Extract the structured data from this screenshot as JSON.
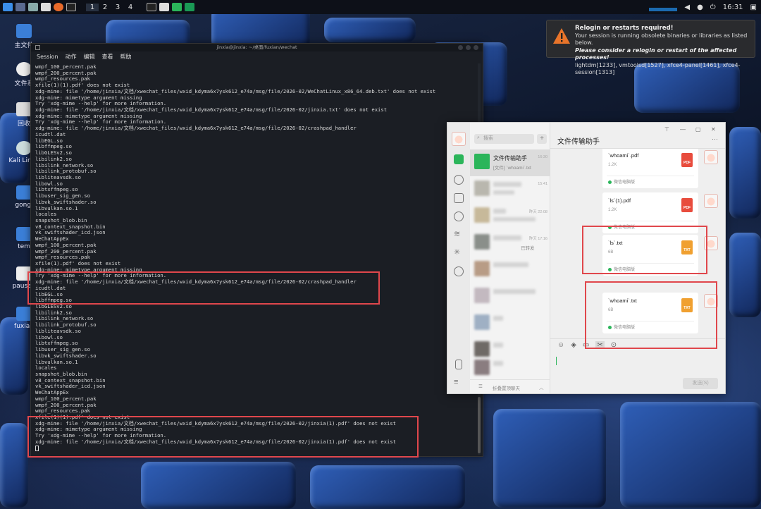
{
  "panel": {
    "workspaces": [
      "1",
      "2",
      "3",
      "4"
    ],
    "clock": "16:31"
  },
  "desktop_icons": [
    {
      "label": "主文件"
    },
    {
      "label": "文件系"
    },
    {
      "label": "回收"
    },
    {
      "label": "Kali Linux"
    },
    {
      "label": "gongj"
    },
    {
      "label": "tem"
    },
    {
      "label": ""
    },
    {
      "label": "paused"
    },
    {
      "label": "fuxian"
    }
  ],
  "notification": {
    "title": "Relogin or restarts required!",
    "line1": "Your session is running obsolete binaries or libraries as listed below.",
    "line2": "Please consider a relogin or restart of the affected processes!",
    "line3": "lightdm[1233], vmtoolsd[1527], xfce4-panel[1461], xfce4-session[1313]"
  },
  "terminal": {
    "title": "jinxia@jinxia: ~/桌面/fuxian/wechat",
    "menu": [
      "Session",
      "动作",
      "编辑",
      "查看",
      "帮助"
    ],
    "lines": [
      "wmpf_100_percent.pak",
      "wmpf_200_percent.pak",
      "wmpf_resources.pak",
      "xfile(1)(1).pdf' does not exist",
      "xdg-mime: file '/home/jinxia/文档/xwechat_files/wxid_kdyma6x7ysk612_e74a/msg/file/2026-02/WeChatLinux_x86_64.deb.txt' does not exist",
      "xdg-mime: mimetype argument missing",
      "Try 'xdg-mime --help' for more information.",
      "xdg-mime: file '/home/jinxia/文档/xwechat_files/wxid_kdyma6x7ysk612_e74a/msg/file/2026-02/jinxia.txt' does not exist",
      "xdg-mime: mimetype argument missing",
      "Try 'xdg-mime --help' for more information.",
      "xdg-mime: file '/home/jinxia/文档/xwechat_files/wxid_kdyma6x7ysk612_e74a/msg/file/2026-02/crashpad_handler",
      "icudtl.dat",
      "libEGL.so",
      "libffmpeg.so",
      "libGLESv2.so",
      "libilink2.so",
      "libilink_network.so",
      "libilink_protobuf.so",
      "libliteavsdk.so",
      "libowl.so",
      "libtxffmpeg.so",
      "libuser_sig_gen.so",
      "libvk_swiftshader.so",
      "libvulkan.so.1",
      "locales",
      "snapshot_blob.bin",
      "v8_context_snapshot.bin",
      "vk_swiftshader_icd.json",
      "WeChatAppEx",
      "wmpf_100_percent.pak",
      "wmpf_200_percent.pak",
      "wmpf_resources.pak",
      "xfile(1).pdf' does not exist",
      "xdg-mime: mimetype argument missing",
      "Try 'xdg-mime --help' for more information.",
      "xdg-mime: file '/home/jinxia/文档/xwechat_files/wxid_kdyma6x7ysk612_e74a/msg/file/2026-02/crashpad_handler",
      "icudtl.dat",
      "libEGL.so",
      "libffmpeg.so",
      "libGLESv2.so",
      "libilink2.so",
      "libilink_network.so",
      "libilink_protobuf.so",
      "libliteavsdk.so",
      "libowl.so",
      "libtxffmpeg.so",
      "libuser_sig_gen.so",
      "libvk_swiftshader.so",
      "libvulkan.so.1",
      "locales",
      "snapshot_blob.bin",
      "v8_context_snapshot.bin",
      "vk_swiftshader_icd.json",
      "WeChatAppEx",
      "wmpf_100_percent.pak",
      "wmpf_200_percent.pak",
      "wmpf_resources.pak",
      "xfile(1)(1).pdf' does not exist",
      "xdg-mime: file '/home/jinxia/文档/xwechat_files/wxid_kdyma6x7ysk612_e74a/msg/file/2026-02/jinxia(1).pdf' does not exist",
      "xdg-mime: mimetype argument missing",
      "Try 'xdg-mime --help' for more information.",
      "xdg-mime: file '/home/jinxia/文档/xwechat_files/wxid_kdyma6x7ysk612_e74a/msg/file/2026-02/jinxia(1).pdf' does not exist"
    ]
  },
  "wechat": {
    "search_placeholder": "搜索",
    "chat_title": "文件传输助手",
    "conversations": [
      {
        "name": "文件传输助手",
        "msg": "[文件] `whoami`.txt",
        "time": "16:30"
      },
      {
        "name": "",
        "msg": "",
        "time": "15:41"
      },
      {
        "name": "",
        "msg": "",
        "time": "昨天 22:08"
      },
      {
        "name": "",
        "msg": "已转发",
        "time": "昨天 17:16"
      },
      {
        "name": "",
        "msg": "",
        "time": ""
      },
      {
        "name": "",
        "msg": "",
        "time": ""
      },
      {
        "name": "",
        "msg": "",
        "time": ""
      },
      {
        "name": "",
        "msg": "",
        "time": ""
      },
      {
        "name": "",
        "msg": "",
        "time": ""
      }
    ],
    "collapsed_label": "折叠置顶聊天",
    "files": [
      {
        "name": "`whoami`.pdf",
        "size": "1.2K",
        "source": "微信电脑版",
        "type": "PDF"
      },
      {
        "name": "`ls`(1).pdf",
        "size": "1.2K",
        "source": "微信电脑版",
        "type": "PDF"
      },
      {
        "name": "`ls`.txt",
        "size": "6B",
        "source": "微信电脑版",
        "type": "TXT"
      },
      {
        "name": "`whoami`.txt",
        "size": "6B",
        "source": "微信电脑版",
        "type": "TXT"
      }
    ],
    "send_label": "发送(S)"
  }
}
